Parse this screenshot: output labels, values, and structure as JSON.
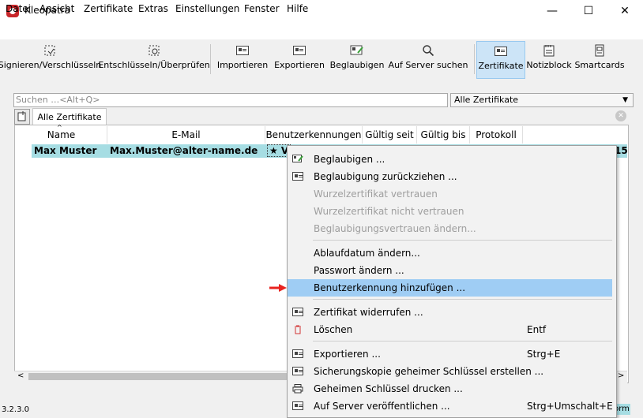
{
  "window": {
    "title": "Kleopatra",
    "minimize": "—",
    "maximize": "☐",
    "close": "✕"
  },
  "menu": [
    "Datei",
    "Ansicht",
    "Zertifikate",
    "Extras",
    "Einstellungen",
    "Fenster",
    "Hilfe"
  ],
  "toolbar": {
    "sign_encrypt": "Signieren/Verschlüsseln",
    "decrypt_verify": "Entschlüsseln/Überprüfen",
    "import": "Importieren",
    "export": "Exportieren",
    "certify": "Beglaubigen",
    "lookup": "Auf Server suchen",
    "certificates": "Zertifikate",
    "notepad": "Notizblock",
    "smartcards": "Smartcards"
  },
  "search": {
    "placeholder": "Suchen …<Alt+Q>",
    "filter_selected": "Alle Zertifikate"
  },
  "tabs": [
    {
      "label": "Alle Zertifikate"
    }
  ],
  "table": {
    "headers": [
      "Name",
      "E-Mail",
      "Benutzerkennungen",
      "Gültig seit",
      "Gültig bis",
      "Protokoll"
    ],
    "rows": [
      {
        "name": "Max Muster",
        "email": "Max.Muster@alter-name.de",
        "uid": "★ V",
        "tail": "15"
      }
    ]
  },
  "context_menu": {
    "items": [
      {
        "label": "Beglaubigen ...",
        "icon": "certify-icon",
        "enabled": true
      },
      {
        "label": "Beglaubigung zurückziehen ...",
        "icon": "card-icon",
        "enabled": true
      },
      {
        "label": "Wurzelzertifikat vertrauen",
        "enabled": false
      },
      {
        "label": "Wurzelzertifikat nicht vertrauen",
        "enabled": false
      },
      {
        "label": "Beglaubigungsvertrauen ändern...",
        "enabled": false
      },
      {
        "label": "Ablaufdatum ändern...",
        "enabled": true
      },
      {
        "label": "Passwort ändern ...",
        "enabled": true
      },
      {
        "label": "Benutzerkennung hinzufügen ...",
        "enabled": true,
        "highlighted": true
      },
      {
        "label": "Zertifikat widerrufen ...",
        "icon": "card-icon",
        "enabled": true
      },
      {
        "label": "Löschen",
        "shortcut": "Entf",
        "icon": "trash-icon",
        "enabled": true
      },
      {
        "label": "Exportieren ...",
        "shortcut": "Strg+E",
        "icon": "export-icon",
        "enabled": true
      },
      {
        "label": "Sicherungskopie geheimer Schlüssel erstellen ...",
        "icon": "export-icon",
        "enabled": true
      },
      {
        "label": "Geheimen Schlüssel drucken ...",
        "icon": "printer-icon",
        "enabled": true
      },
      {
        "label": "Auf Server veröffentlichen ...",
        "shortcut": "Strg+Umschalt+E",
        "icon": "export-icon",
        "enabled": true
      }
    ]
  },
  "status": {
    "version": "3.2.3.0",
    "right": "orm"
  },
  "colors": {
    "selection": "#a6dde3",
    "menu_highlight": "#9fcdf4",
    "arrow": "#e8231f",
    "active_tool": "#cce4f7"
  }
}
